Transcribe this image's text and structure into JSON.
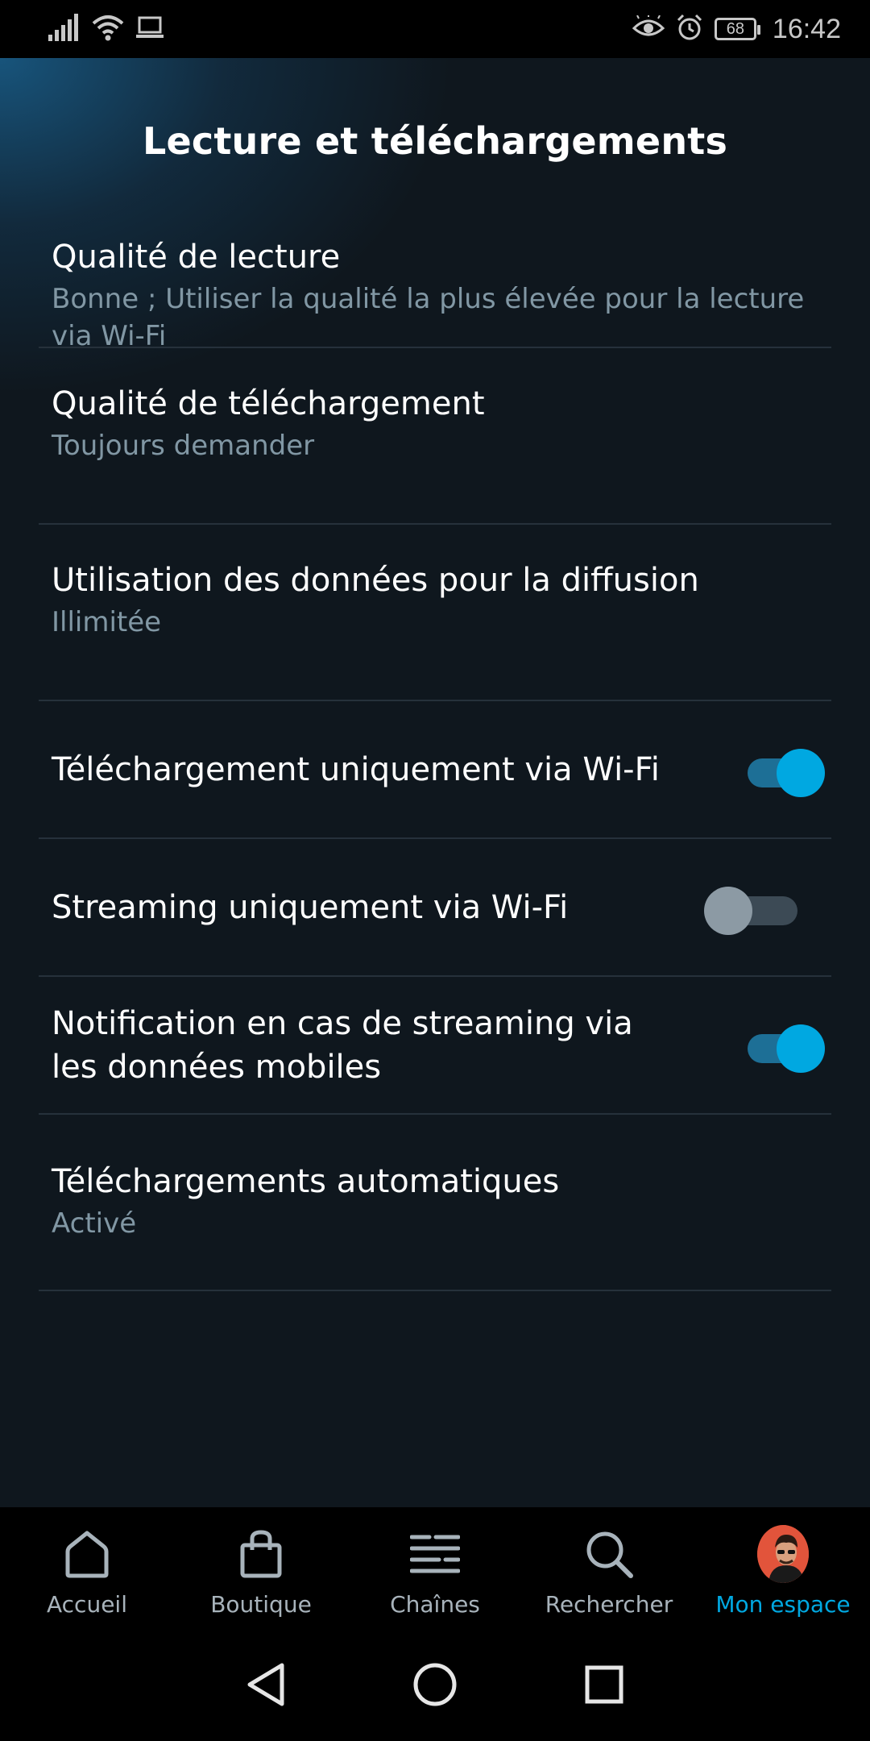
{
  "status_bar": {
    "time": "16:42",
    "battery": "68"
  },
  "page": {
    "title": "Lecture et téléchargements"
  },
  "settings": [
    {
      "title": "Qualité de lecture",
      "subtitle": "Bonne ; Utiliser la qualité la plus élevée pour la lecture via Wi-Fi"
    },
    {
      "title": "Qualité de téléchargement",
      "subtitle": "Toujours demander"
    },
    {
      "title": "Utilisation des données pour la diffusion",
      "subtitle": "Illimitée"
    },
    {
      "title": "Téléchargement uniquement via Wi-Fi",
      "toggle": true
    },
    {
      "title": "Streaming uniquement via Wi-Fi",
      "toggle": false
    },
    {
      "title": "Notification en cas de streaming via les données mobiles",
      "toggle": true
    },
    {
      "title": "Téléchargements automatiques",
      "subtitle": "Activé"
    }
  ],
  "bottom_nav": [
    {
      "label": "Accueil",
      "icon": "home-icon"
    },
    {
      "label": "Boutique",
      "icon": "shopping-bag-icon"
    },
    {
      "label": "Chaînes",
      "icon": "channels-icon"
    },
    {
      "label": "Rechercher",
      "icon": "search-icon"
    },
    {
      "label": "Mon espace",
      "icon": "avatar",
      "active": true
    }
  ],
  "colors": {
    "background": "#0f171e",
    "accent": "#00a8e1",
    "subtitle": "#8197a4",
    "divider": "#26313b"
  }
}
